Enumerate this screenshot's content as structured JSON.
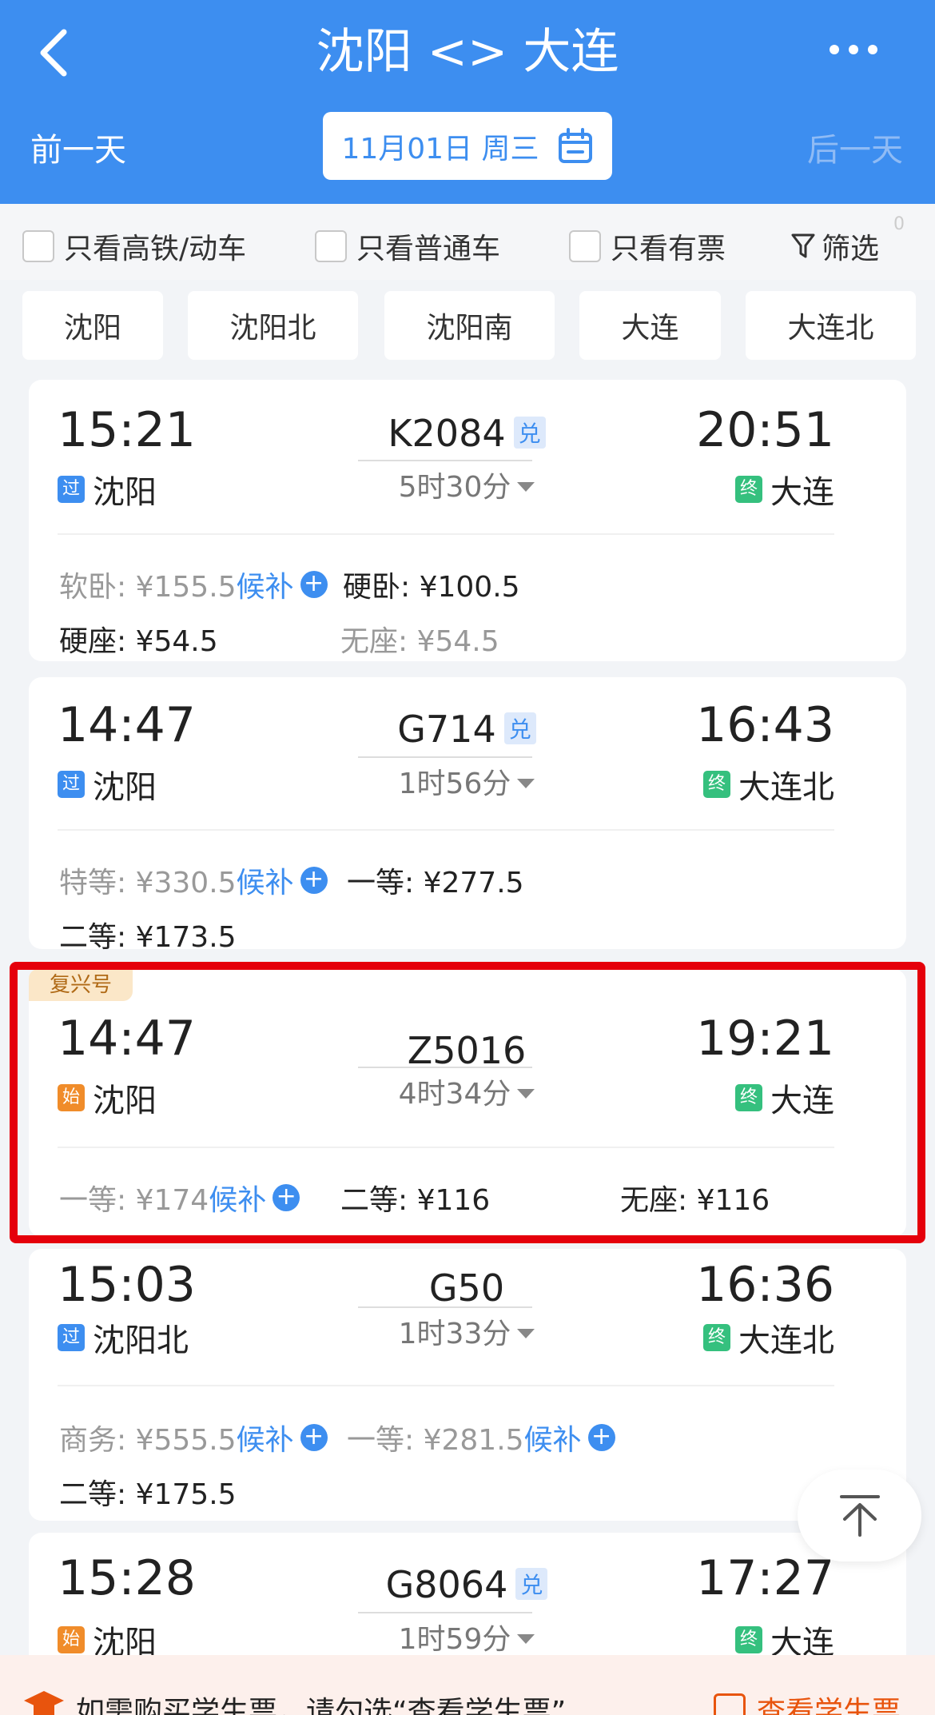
{
  "header": {
    "title": "沈阳 <> 大连",
    "prev_day": "前一天",
    "next_day": "后一天",
    "date": "11月01日",
    "weekday": "周三"
  },
  "filters": {
    "high_speed": "只看高铁/动车",
    "normal": "只看普通车",
    "available": "只看有票",
    "filter": "筛选",
    "filter_count": "0"
  },
  "stations": [
    "沈阳",
    "沈阳北",
    "沈阳南",
    "大连",
    "大连北"
  ],
  "trains": [
    {
      "dep_time": "15:21",
      "arr_time": "20:51",
      "number": "K2084",
      "badge": "兑",
      "duration": "5时30分",
      "dep_tag": "过",
      "dep_station": "沈阳",
      "arr_tag": "终",
      "arr_station": "大连",
      "prices": [
        {
          "label": "软卧: ¥155.5",
          "extra": "候补"
        },
        {
          "label": "硬卧: ¥100.5"
        },
        {
          "label": "硬座: ¥54.5"
        },
        {
          "label": "无座: ¥54.5"
        }
      ]
    },
    {
      "dep_time": "14:47",
      "arr_time": "16:43",
      "number": "G714",
      "badge": "兑",
      "duration": "1时56分",
      "dep_tag": "过",
      "dep_station": "沈阳",
      "arr_tag": "终",
      "arr_station": "大连北",
      "prices": [
        {
          "label": "特等: ¥330.5",
          "extra": "候补"
        },
        {
          "label": "一等: ¥277.5"
        },
        {
          "label": "二等: ¥173.5"
        }
      ]
    },
    {
      "ribbon": "复兴号",
      "dep_time": "14:47",
      "arr_time": "19:21",
      "number": "Z5016",
      "duration": "4时34分",
      "dep_tag": "始",
      "dep_station": "沈阳",
      "arr_tag": "终",
      "arr_station": "大连",
      "prices": [
        {
          "label": "一等: ¥174",
          "extra": "候补"
        },
        {
          "label": "二等: ¥116"
        },
        {
          "label": "无座: ¥116"
        }
      ]
    },
    {
      "dep_time": "15:03",
      "arr_time": "16:36",
      "number": "G50",
      "duration": "1时33分",
      "dep_tag": "过",
      "dep_station": "沈阳北",
      "arr_tag": "终",
      "arr_station": "大连北",
      "prices": [
        {
          "label": "商务: ¥555.5",
          "extra": "候补"
        },
        {
          "label": "一等: ¥281.5",
          "extra": "候补"
        },
        {
          "label": "二等: ¥175.5"
        }
      ]
    },
    {
      "dep_time": "15:28",
      "arr_time": "17:27",
      "number": "G8064",
      "badge": "兑",
      "duration": "1时59分",
      "dep_tag": "始",
      "dep_station": "沈阳",
      "arr_tag": "终",
      "arr_station": "大连"
    }
  ],
  "bottom": {
    "notice": "如需购买学生票，请勾选“查看学生票”",
    "student_check": "查看学生票"
  }
}
